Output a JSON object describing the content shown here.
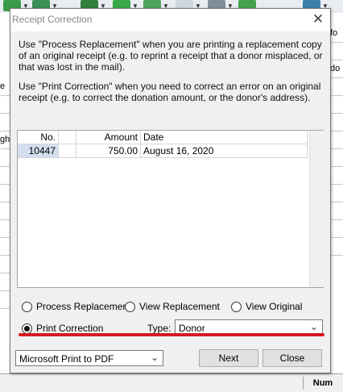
{
  "background": {
    "left_cells": [
      "e",
      "",
      "",
      "gh",
      "",
      "",
      "",
      "",
      "",
      "",
      "",
      "",
      ""
    ],
    "right_cells": [
      "fo",
      "",
      "do",
      "",
      "",
      "",
      "",
      "",
      "",
      "",
      "",
      "",
      ""
    ],
    "status": {
      "num_indicator": "Num"
    }
  },
  "dialog": {
    "title": "Receipt Correction",
    "close_symbol": "✕",
    "instructions": [
      "Use \"Process Replacement\" when you are printing a replacement copy of an original receipt (e.g. to reprint a receipt that a donor misplaced, or that was lost in the mail).",
      "Use \"Print Correction\" when you need to correct an error on an original receipt (e.g. to correct the donation amount, or the donor's address)."
    ],
    "grid": {
      "columns": [
        "No.",
        "",
        "Amount",
        "Date"
      ],
      "rows": [
        {
          "no": "10447",
          "flag": "",
          "amount": "750.00",
          "date": "August 16, 2020"
        }
      ]
    },
    "options": {
      "process_replacement": "Process Replacement",
      "view_replacement": "View Replacement",
      "view_original": "View Original",
      "print_correction": "Print Correction",
      "selected": "print_correction"
    },
    "type": {
      "label": "Type:",
      "value": "Donor"
    },
    "printer": {
      "value": "Microsoft Print to PDF"
    },
    "buttons": {
      "next": "Next",
      "close": "Close"
    },
    "highlight_color": "#d71920"
  }
}
